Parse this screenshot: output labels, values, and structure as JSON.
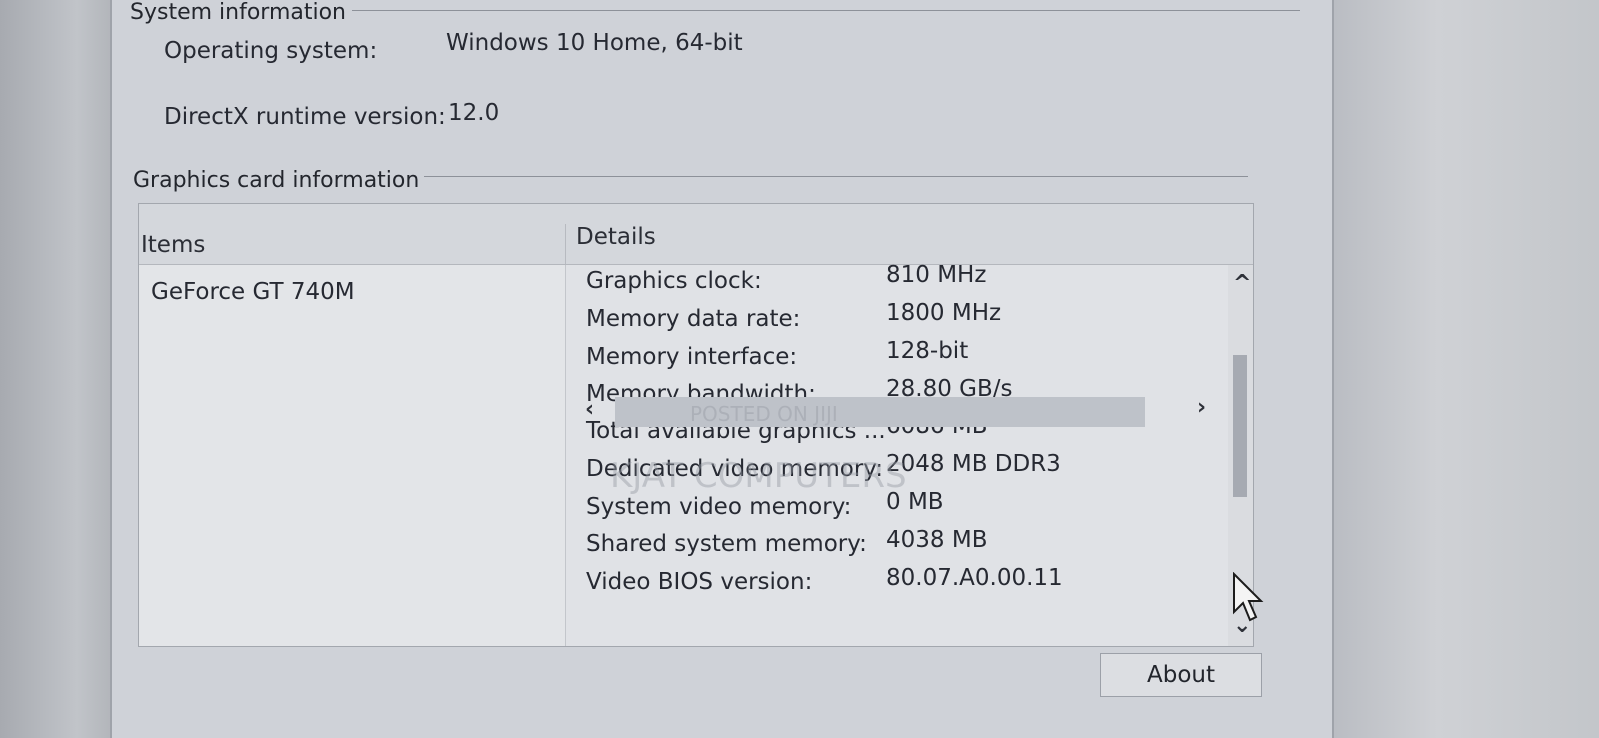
{
  "system_info": {
    "group_title": "System information",
    "os_label": "Operating system:",
    "os_value": "Windows 10 Home, 64-bit",
    "directx_label": "DirectX runtime version:",
    "directx_value": "12.0"
  },
  "graphics_info": {
    "group_title": "Graphics card information",
    "columns": {
      "items": "Items",
      "details": "Details"
    },
    "items": [
      "GeForce GT 740M"
    ],
    "details": [
      {
        "label": "Graphics clock:",
        "value": "810 MHz"
      },
      {
        "label": "Memory data rate:",
        "value": "1800 MHz"
      },
      {
        "label": "Memory interface:",
        "value": "128-bit"
      },
      {
        "label": "Memory bandwidth:",
        "value": "28.80 GB/s"
      },
      {
        "label": "Total available graphics ...",
        "value": "6086 MB"
      },
      {
        "label": "Dedicated video memory:",
        "value": "2048 MB DDR3"
      },
      {
        "label": "System video memory:",
        "value": "0 MB"
      },
      {
        "label": "Shared system memory:",
        "value": "4038 MB"
      },
      {
        "label": "Video BIOS version:",
        "value": "80.07.A0.00.11"
      }
    ]
  },
  "buttons": {
    "about": "About"
  },
  "watermark": {
    "line1": "POSTED ON JIJI",
    "line2": "KJAT COMPUTERS"
  },
  "icons": {
    "scroll_up": "chevron-up-icon",
    "scroll_down": "chevron-down-icon",
    "scroll_left": "chevron-left-icon",
    "scroll_right": "chevron-right-icon",
    "cursor": "mouse-pointer-icon"
  }
}
